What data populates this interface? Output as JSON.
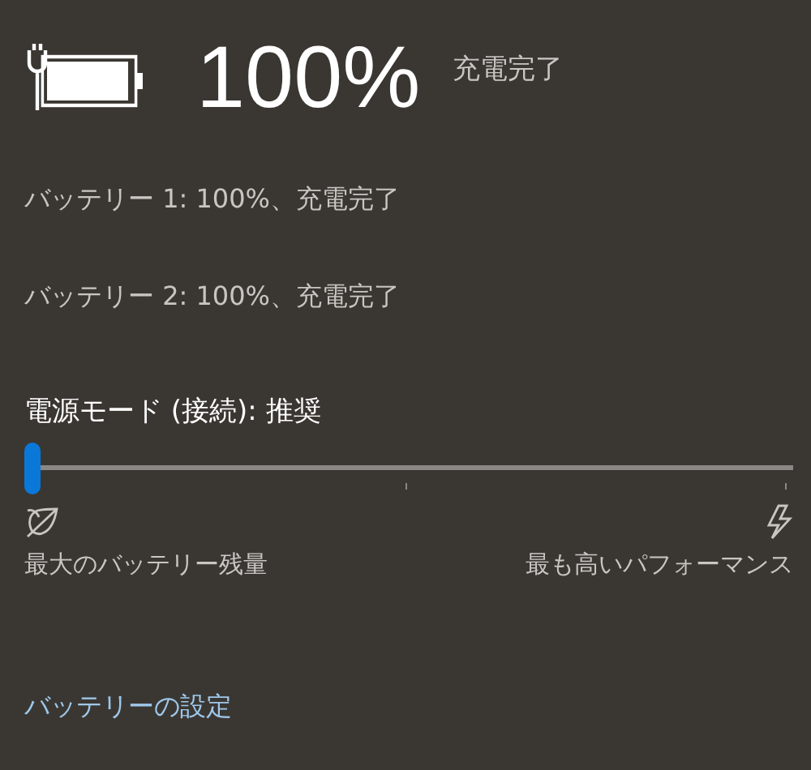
{
  "battery": {
    "percent": "100%",
    "status": "充電完了"
  },
  "batteries": [
    {
      "label": "バッテリー 1: 100%、充電完了"
    },
    {
      "label": "バッテリー 2: 100%、充電完了"
    }
  ],
  "power_mode": {
    "label": "電源モード (接続): 推奨",
    "level": 0,
    "min_label": "最大のバッテリー残量",
    "max_label": "最も高いパフォーマンス"
  },
  "settings_link": "バッテリーの設定"
}
